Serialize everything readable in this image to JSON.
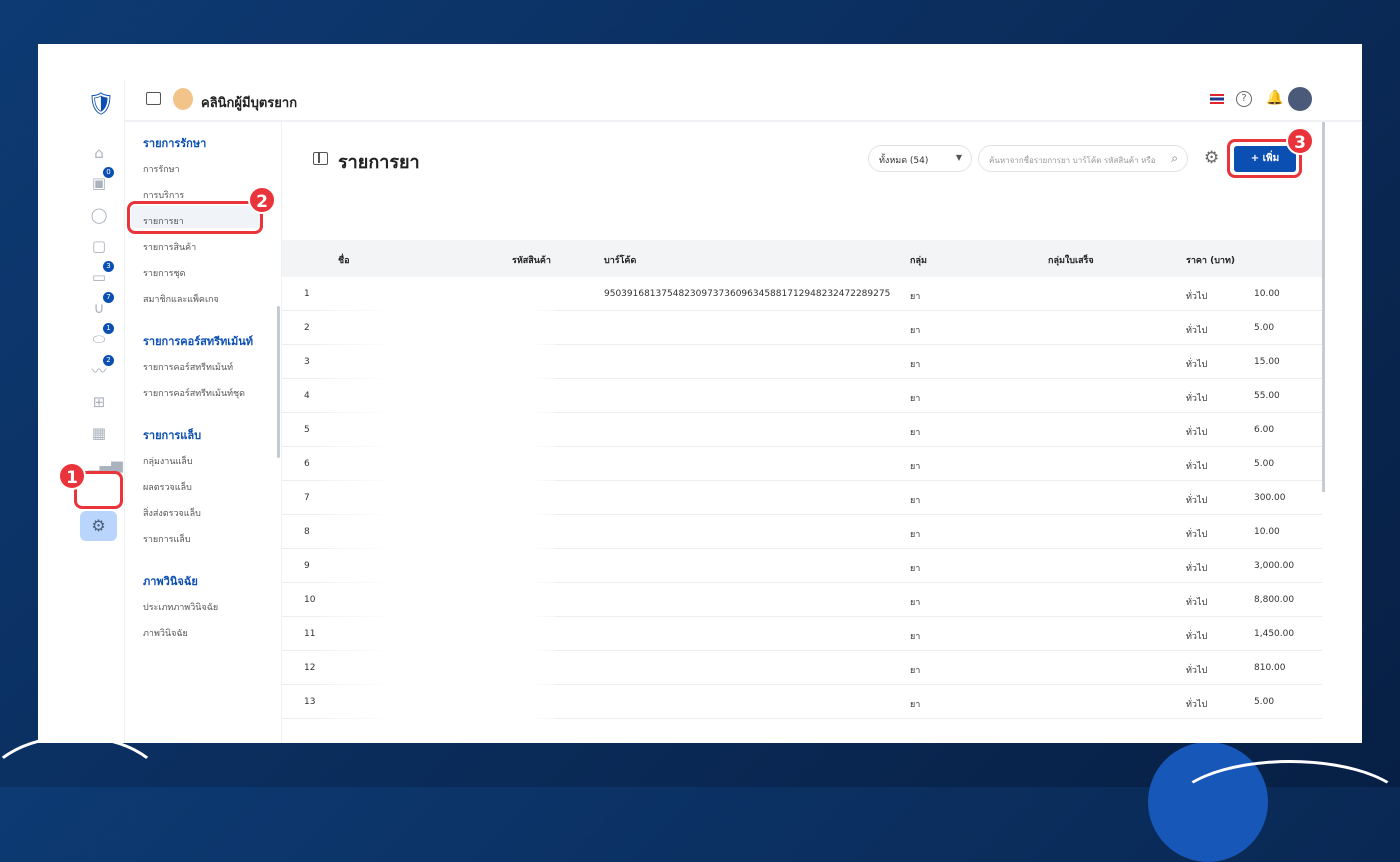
{
  "header": {
    "clinic_name": "คลินิกผู้มีบุตรยาก"
  },
  "rail": {
    "badges": [
      "0",
      "3",
      "7",
      "1",
      "2"
    ]
  },
  "submenu": {
    "sections": [
      {
        "title": "รายการรักษา",
        "items": [
          "การรักษา",
          "การบริการ",
          "รายการยา",
          "รายการสินค้า",
          "รายการชุด",
          "สมาชิกและแพ็คเกจ"
        ]
      },
      {
        "title": "รายการคอร์สทรีทเม้นท์",
        "items": [
          "รายการคอร์สทรีทเม้นท์",
          "รายการคอร์สทรีทเม้นท์ชุด"
        ]
      },
      {
        "title": "รายการแล็บ",
        "items": [
          "กลุ่มงานแล็บ",
          "ผลตรวจแล็บ",
          "สิ่งส่งตรวจแล็บ",
          "รายการแล็บ"
        ]
      },
      {
        "title": "ภาพวินิจฉัย",
        "items": [
          "ประเภทภาพวินิจฉัย",
          "ภาพวินิจฉัย"
        ]
      }
    ]
  },
  "main": {
    "title": "รายการยา",
    "filter": "ทั้งหมด (54)",
    "search_placeholder": "ค้นหาจากชื่อรายการยา บาร์โค้ด รหัสสินค้า หรือ",
    "add_label": "+ เพิ่ม",
    "columns": [
      "ชื่อ",
      "รหัสสินค้า",
      "บาร์โค้ด",
      "กลุ่ม",
      "กลุ่มใบเสร็จ",
      "ราคา (บาท)"
    ],
    "rows": [
      {
        "no": "1",
        "barcode": "9503916813754823097373609634588171294823247228927​5",
        "group": "ยา",
        "type": "ทั่วไป",
        "price": "10.00"
      },
      {
        "no": "2",
        "barcode": "",
        "group": "ยา",
        "type": "ทั่วไป",
        "price": "5.00"
      },
      {
        "no": "3",
        "barcode": "",
        "group": "ยา",
        "type": "ทั่วไป",
        "price": "15.00"
      },
      {
        "no": "4",
        "barcode": "",
        "group": "ยา",
        "type": "ทั่วไป",
        "price": "55.00"
      },
      {
        "no": "5",
        "barcode": "",
        "group": "ยา",
        "type": "ทั่วไป",
        "price": "6.00"
      },
      {
        "no": "6",
        "barcode": "",
        "group": "ยา",
        "type": "ทั่วไป",
        "price": "5.00"
      },
      {
        "no": "7",
        "barcode": "",
        "group": "ยา",
        "type": "ทั่วไป",
        "price": "300.00"
      },
      {
        "no": "8",
        "barcode": "",
        "group": "ยา",
        "type": "ทั่วไป",
        "price": "10.00"
      },
      {
        "no": "9",
        "barcode": "",
        "group": "ยา",
        "type": "ทั่วไป",
        "price": "3,000.00"
      },
      {
        "no": "10",
        "barcode": "",
        "group": "ยา",
        "type": "ทั่วไป",
        "price": "8,800.00"
      },
      {
        "no": "11",
        "barcode": "",
        "group": "ยา",
        "type": "ทั่วไป",
        "price": "1,450.00"
      },
      {
        "no": "12",
        "barcode": "",
        "group": "ยา",
        "type": "ทั่วไป",
        "price": "810.00"
      },
      {
        "no": "13",
        "barcode": "",
        "group": "ยา",
        "type": "ทั่วไป",
        "price": "5.00"
      }
    ]
  },
  "annotations": [
    "1",
    "2",
    "3"
  ]
}
